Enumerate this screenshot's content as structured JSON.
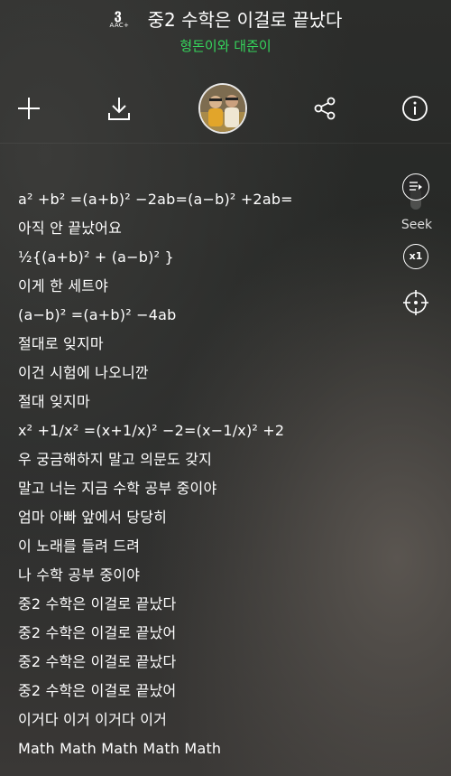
{
  "header": {
    "badge_mark": "ვ",
    "badge_text": "AAC+",
    "title": "중2 수학은 이걸로 끝났다",
    "artist": "형돈이와 대준이",
    "accent_color": "#35d65c"
  },
  "toolbar": {
    "icons": [
      "plus-icon",
      "download-icon",
      "album-art",
      "share-icon",
      "info-icon"
    ]
  },
  "side": {
    "seek_label": "Seek",
    "speed_label": "x1"
  },
  "lyrics": [
    "a² +b² =(a+b)² −2ab=(a−b)² +2ab=",
    "아직 안 끝났어요",
    "½{(a+b)² + (a−b)² }",
    "이게 한 세트야",
    "(a−b)² =(a+b)² −4ab",
    "절대로 잊지마",
    "이건 시험에 나오니깐",
    "절대 잊지마",
    "x² +1/x² =(x+1/x)² −2=(x−1/x)² +2",
    "우 궁금해하지 말고 의문도 갖지",
    "말고 너는 지금 수학 공부 중이야",
    "엄마 아빠 앞에서 당당히",
    "이 노래를 들려 드려",
    "나 수학 공부 중이야",
    "중2 수학은 이걸로 끝났다",
    "중2 수학은 이걸로 끝났어",
    "중2 수학은 이걸로 끝났다",
    "중2 수학은 이걸로 끝났어",
    "이거다 이거 이거다 이거",
    "Math Math Math Math Math"
  ]
}
